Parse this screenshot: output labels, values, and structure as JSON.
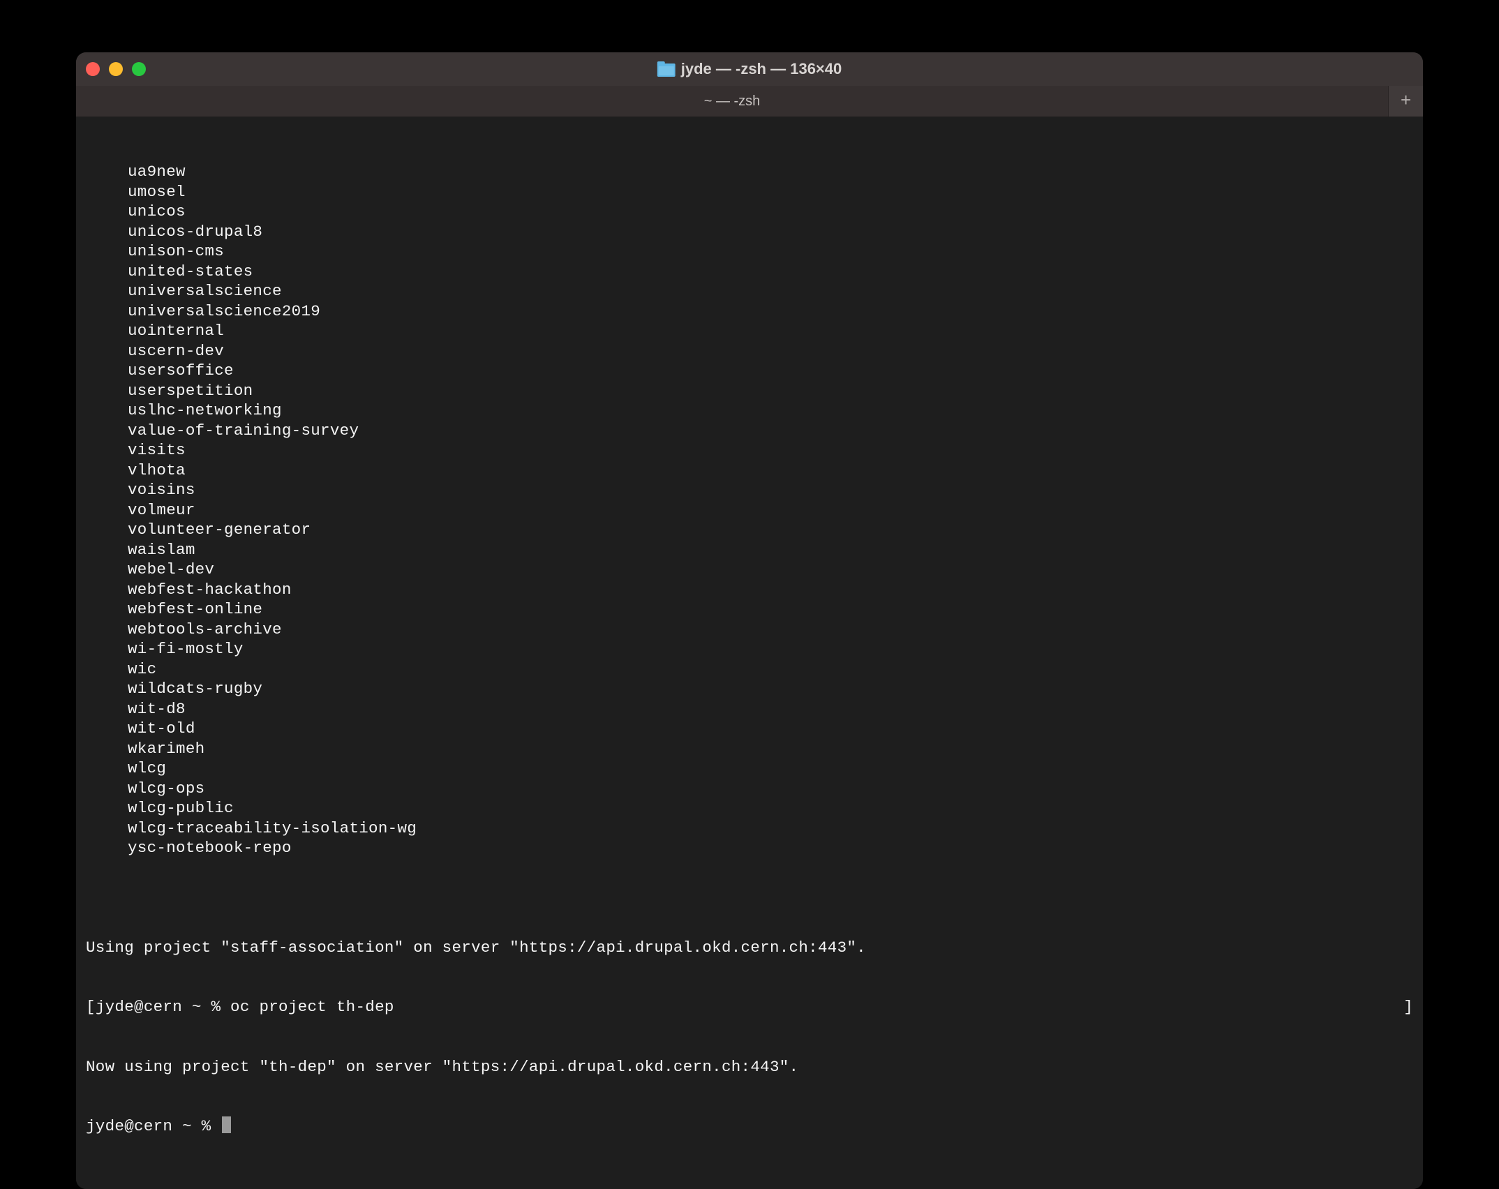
{
  "window": {
    "title": "jyde — -zsh — 136×40",
    "tab_label": "~ — -zsh"
  },
  "list_items": [
    "ua9new",
    "umosel",
    "unicos",
    "unicos-drupal8",
    "unison-cms",
    "united-states",
    "universalscience",
    "universalscience2019",
    "uointernal",
    "uscern-dev",
    "usersoffice",
    "userspetition",
    "uslhc-networking",
    "value-of-training-survey",
    "visits",
    "vlhota",
    "voisins",
    "volmeur",
    "volunteer-generator",
    "waislam",
    "webel-dev",
    "webfest-hackathon",
    "webfest-online",
    "webtools-archive",
    "wi-fi-mostly",
    "wic",
    "wildcats-rugby",
    "wit-d8",
    "wit-old",
    "wkarimeh",
    "wlcg",
    "wlcg-ops",
    "wlcg-public",
    "wlcg-traceability-isolation-wg",
    "ysc-notebook-repo"
  ],
  "blank_line": "",
  "status_line_1": "Using project \"staff-association\" on server \"https://api.drupal.okd.cern.ch:443\".",
  "prompt_prev_bracket": "[",
  "prompt_prev": "jyde@cern ~ % oc project th-dep",
  "right_bracket": "]",
  "status_line_2": "Now using project \"th-dep\" on server \"https://api.drupal.okd.cern.ch:443\".",
  "prompt_current": "jyde@cern ~ % "
}
